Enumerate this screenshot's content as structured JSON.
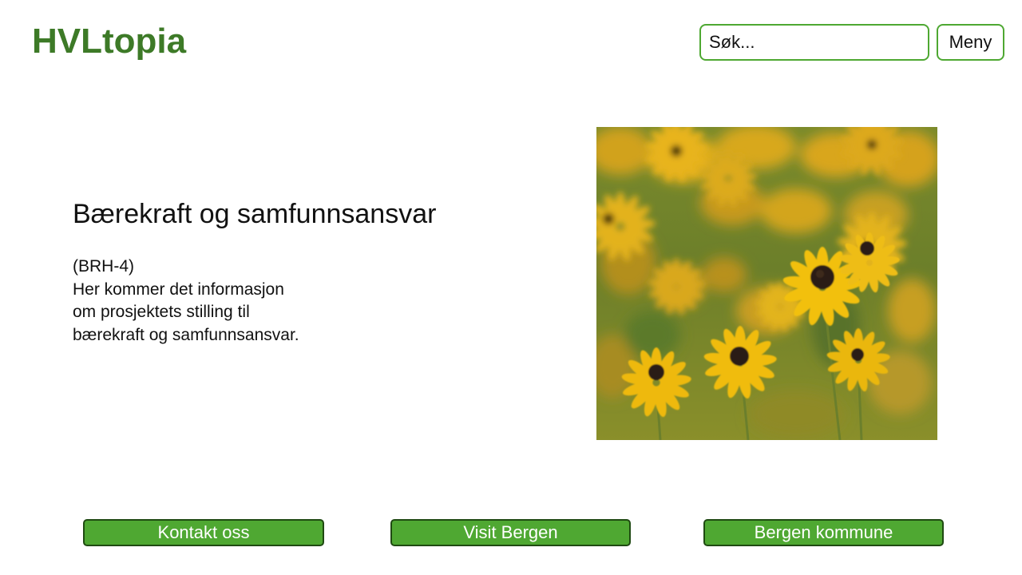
{
  "header": {
    "logo": "HVLtopia",
    "search_placeholder": "Søk...",
    "menu_label": "Meny"
  },
  "main": {
    "title": "Bærekraft og samfunnsansvar",
    "paragraph_lines": [
      "(BRH-4)",
      "Her kommer det informasjon",
      "om prosjektets stilling til",
      "bærekraft og samfunnsansvar."
    ],
    "image_subject": "black-eyed-susan-flowers-photo"
  },
  "footer": {
    "buttons": [
      "Kontakt oss",
      "Visit Bergen",
      "Bergen kommune"
    ]
  },
  "colors": {
    "brand_green": "#3d7a27",
    "border_green": "#4ea832",
    "button_green": "#4fa832",
    "button_border": "#1f4a12"
  }
}
